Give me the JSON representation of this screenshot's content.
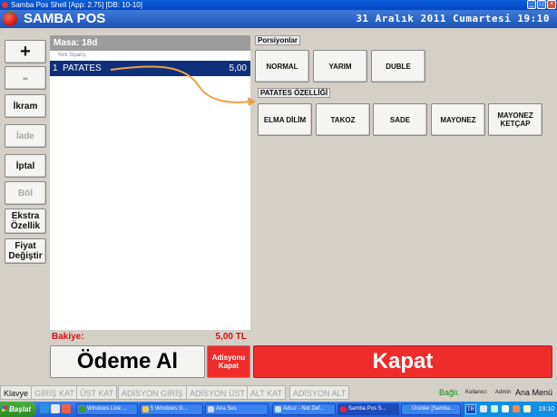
{
  "window": {
    "title": "Samba Pos Shell [App: 2.75] [DB: 10-10]",
    "controls": {
      "minimize": "_",
      "maximize": "□",
      "close": "×"
    }
  },
  "header": {
    "app_name": "SAMBA POS",
    "date": "31 Aralık 2011 Cumartesi 19:10"
  },
  "commands": {
    "plus": "+",
    "minus": "-",
    "ikram": "İkram",
    "iade": "İade",
    "iptal": "İptal",
    "bol": "Böl",
    "ekstra": "Ekstra Özellik",
    "fiyat": "Fiyat Değiştir"
  },
  "ticket": {
    "header": "Masa: 18d",
    "subheader": "Yeni Sipariş",
    "items": [
      {
        "qty": "1",
        "name": "PATATES",
        "price": "5,00"
      }
    ],
    "balance_label": "Bakiye:",
    "balance_value": "5,00 TL"
  },
  "portions": {
    "label": "Porsiyonlar",
    "options": [
      "NORMAL",
      "YARIM",
      "DUBLE"
    ]
  },
  "properties": {
    "label": "PATATES ÖZELLİĞİ",
    "options": [
      "ELMA DİLİM",
      "TAKOZ",
      "SADE",
      "MAYONEZ",
      "MAYONEZ KETÇAP"
    ]
  },
  "actions": {
    "odeme": "Ödeme Al",
    "adisyon": "Adisyonu Kapat",
    "kapat": "Kapat"
  },
  "function_bar": {
    "buttons": [
      "Klavye",
      "GİRİŞ KAT",
      "ÜST KAT",
      "ADİSYON GİRİŞ",
      "ADİSYON ÜST",
      "ALT KAT",
      "ADİSYON ALT"
    ],
    "status": "Bağlı.",
    "user_label": "Kullanıcı:",
    "user": "Admin",
    "main_menu": "Ana Menü"
  },
  "taskbar": {
    "start": "Başlat",
    "tasks": [
      "Windows Live ...",
      "5 Windows G...",
      "Ana Ses",
      "Adsız - Not Def...",
      "Samba Pos S...",
      "Ürünler [Samba..."
    ],
    "lang": "TR",
    "clock": "19:10"
  },
  "colors": {
    "accent_red": "#ee2c2c",
    "selected_row": "#0e2f7a",
    "connected_green": "#1a8a1a",
    "arrow_orange": "#f0a040"
  }
}
